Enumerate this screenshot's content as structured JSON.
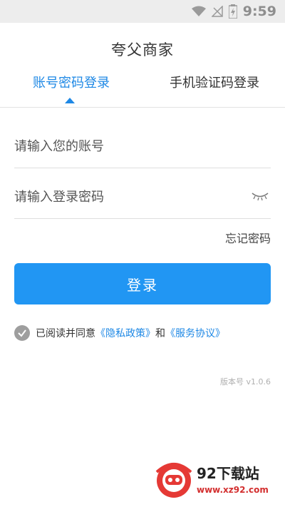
{
  "status": {
    "time": "9:59"
  },
  "app": {
    "title": "夸父商家"
  },
  "tabs": [
    {
      "label": "账号密码登录",
      "active": true
    },
    {
      "label": "手机验证码登录",
      "active": false
    }
  ],
  "form": {
    "account_placeholder": "请输入您的账号",
    "password_placeholder": "请输入登录密码",
    "forgot_label": "忘记密码",
    "login_label": "登录"
  },
  "agreement": {
    "prefix": "已阅读并同意",
    "privacy": "《隐私政策》",
    "and": "和",
    "service": "《服务协议》",
    "checked": true
  },
  "version": "版本号 v1.0.6",
  "watermark": {
    "title": "92下载站",
    "url": "www.xz92.com"
  },
  "colors": {
    "accent": "#2196f3",
    "link": "#1e88e5"
  }
}
